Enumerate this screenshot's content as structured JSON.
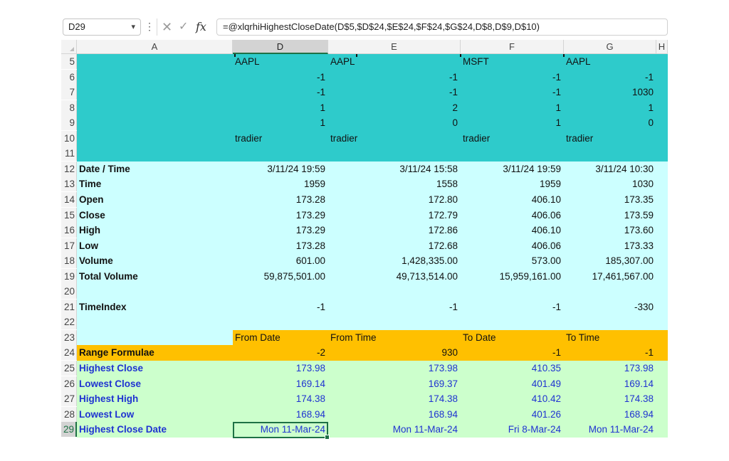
{
  "name_box": {
    "value": "D29",
    "chevron_icon": "chevron-down-icon"
  },
  "formula_bar": {
    "more_icon": "⋮",
    "cancel_icon": "✕",
    "enter_icon": "✓",
    "fx_label": "fx",
    "formula": "=@xlqrhiHighestCloseDate(D$5,$D$24,$E$24,$F$24,$G$24,D$8,D$9,D$10)"
  },
  "columns": [
    "A",
    "D",
    "E",
    "F",
    "G",
    "H"
  ],
  "selected_column": "D",
  "selected_row": "29",
  "colors": {
    "teal": "#2ecbcb",
    "light_cyan": "#ccffff",
    "orange": "#ffc000",
    "light_green": "#ccffcc",
    "blue_text": "#1f33d1",
    "selection_green": "#1e7145"
  },
  "rows": {
    "r5": {
      "num": "5",
      "A": "",
      "D": "AAPL",
      "E": "AAPL",
      "F": "MSFT",
      "G": "AAPL"
    },
    "r6": {
      "num": "6",
      "A": "",
      "D": "-1",
      "E": "-1",
      "F": "-1",
      "G": "-1"
    },
    "r7": {
      "num": "7",
      "A": "",
      "D": "-1",
      "E": "-1",
      "F": "-1",
      "G": "1030"
    },
    "r8": {
      "num": "8",
      "A": "",
      "D": "1",
      "E": "2",
      "F": "1",
      "G": "1"
    },
    "r9": {
      "num": "9",
      "A": "",
      "D": "1",
      "E": "0",
      "F": "1",
      "G": "0"
    },
    "r10": {
      "num": "10",
      "A": "",
      "D": "tradier",
      "E": "tradier",
      "F": "tradier",
      "G": "tradier"
    },
    "r11": {
      "num": "11"
    },
    "r12": {
      "num": "12",
      "A": "Date / Time",
      "D": "3/11/24 19:59",
      "E": "3/11/24 15:58",
      "F": "3/11/24 19:59",
      "G": "3/11/24 10:30"
    },
    "r13": {
      "num": "13",
      "A": "Time",
      "D": "1959",
      "E": "1558",
      "F": "1959",
      "G": "1030"
    },
    "r14": {
      "num": "14",
      "A": "Open",
      "D": "173.28",
      "E": "172.80",
      "F": "406.10",
      "G": "173.35"
    },
    "r15": {
      "num": "15",
      "A": "Close",
      "D": "173.29",
      "E": "172.79",
      "F": "406.06",
      "G": "173.59"
    },
    "r16": {
      "num": "16",
      "A": "High",
      "D": "173.29",
      "E": "172.86",
      "F": "406.10",
      "G": "173.60"
    },
    "r17": {
      "num": "17",
      "A": "Low",
      "D": "173.28",
      "E": "172.68",
      "F": "406.06",
      "G": "173.33"
    },
    "r18": {
      "num": "18",
      "A": "Volume",
      "D": "601.00",
      "E": "1,428,335.00",
      "F": "573.00",
      "G": "185,307.00"
    },
    "r19": {
      "num": "19",
      "A": "Total Volume",
      "D": "59,875,501.00",
      "E": "49,713,514.00",
      "F": "15,959,161.00",
      "G": "17,461,567.00"
    },
    "r20": {
      "num": "20"
    },
    "r21": {
      "num": "21",
      "A": "TimeIndex",
      "D": "-1",
      "E": "-1",
      "F": "-1",
      "G": "-330"
    },
    "r22": {
      "num": "22"
    },
    "r23": {
      "num": "23",
      "A": "",
      "D": "From Date",
      "E": "From Time",
      "F": "To Date",
      "G": "To Time"
    },
    "r24": {
      "num": "24",
      "A": "Range Formulae",
      "D": "-2",
      "E": "930",
      "F": "-1",
      "G": "-1"
    },
    "r25": {
      "num": "25",
      "A": "Highest Close",
      "D": "173.98",
      "E": "173.98",
      "F": "410.35",
      "G": "173.98"
    },
    "r26": {
      "num": "26",
      "A": "Lowest Close",
      "D": "169.14",
      "E": "169.37",
      "F": "401.49",
      "G": "169.14"
    },
    "r27": {
      "num": "27",
      "A": "Highest High",
      "D": "174.38",
      "E": "174.38",
      "F": "410.42",
      "G": "174.38"
    },
    "r28": {
      "num": "28",
      "A": "Lowest Low",
      "D": "168.94",
      "E": "168.94",
      "F": "401.26",
      "G": "168.94"
    },
    "r29": {
      "num": "29",
      "A": "Highest Close Date",
      "D": "Mon 11-Mar-24",
      "E": "Mon 11-Mar-24",
      "F": "Fri 8-Mar-24",
      "G": "Mon 11-Mar-24"
    }
  }
}
